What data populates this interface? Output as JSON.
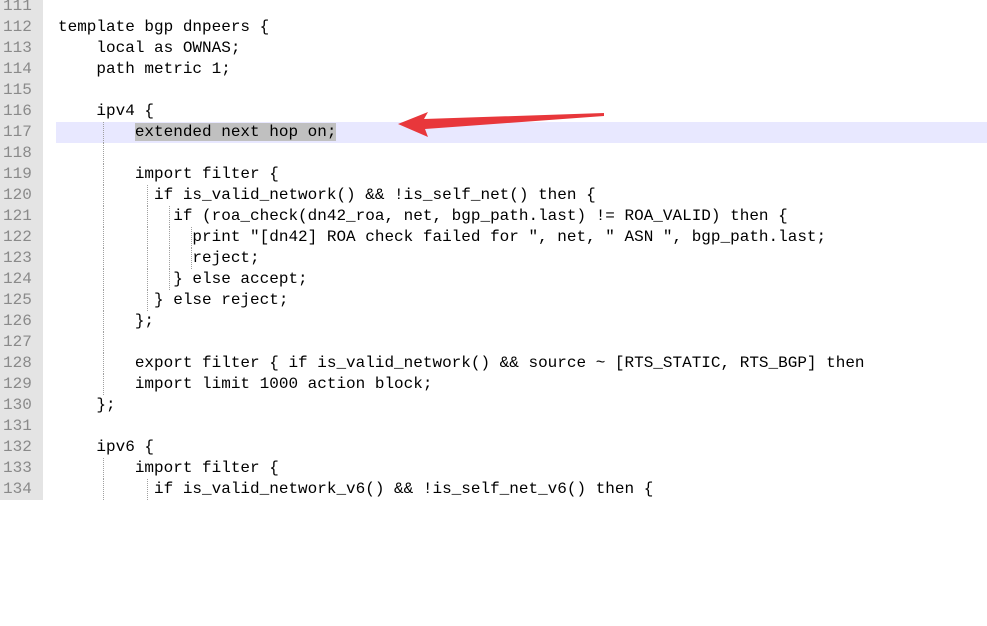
{
  "editor": {
    "current_line": 117,
    "colors": {
      "gutter_bg": "#e4e4e4",
      "current_line_bg": "#e8e8ff",
      "selection_bg": "#c0c0c0",
      "annotation_arrow": "#e8373b"
    },
    "lines": [
      {
        "num": "111",
        "text": ""
      },
      {
        "num": "112",
        "text": "template bgp dnpeers {"
      },
      {
        "num": "113",
        "text": "    local as OWNAS;"
      },
      {
        "num": "114",
        "text": "    path metric 1;"
      },
      {
        "num": "115",
        "text": ""
      },
      {
        "num": "116",
        "text": "    ipv4 {"
      },
      {
        "num": "117",
        "text": "        ",
        "selected": "extended next hop on;"
      },
      {
        "num": "118",
        "text": ""
      },
      {
        "num": "119",
        "text": "        import filter {"
      },
      {
        "num": "120",
        "text": "          if is_valid_network() && !is_self_net() then {"
      },
      {
        "num": "121",
        "text": "            if (roa_check(dn42_roa, net, bgp_path.last) != ROA_VALID) then {"
      },
      {
        "num": "122",
        "text": "              print \"[dn42] ROA check failed for \", net, \" ASN \", bgp_path.last;"
      },
      {
        "num": "123",
        "text": "              reject;"
      },
      {
        "num": "124",
        "text": "            } else accept;"
      },
      {
        "num": "125",
        "text": "          } else reject;"
      },
      {
        "num": "126",
        "text": "        };"
      },
      {
        "num": "127",
        "text": ""
      },
      {
        "num": "128",
        "text": "        export filter { if is_valid_network() && source ~ [RTS_STATIC, RTS_BGP] then"
      },
      {
        "num": "129",
        "text": "        import limit 1000 action block;"
      },
      {
        "num": "130",
        "text": "    };"
      },
      {
        "num": "131",
        "text": ""
      },
      {
        "num": "132",
        "text": "    ipv6 {"
      },
      {
        "num": "133",
        "text": "        import filter {"
      },
      {
        "num": "134",
        "text": "          if is_valid_network_v6() && !is_self_net_v6() then {"
      }
    ]
  }
}
